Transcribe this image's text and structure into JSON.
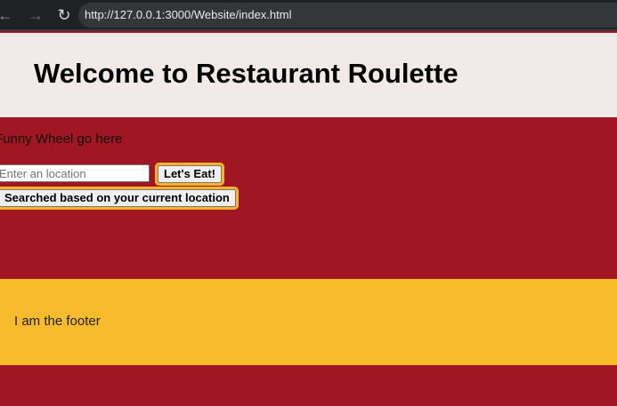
{
  "browser": {
    "url": "http://127.0.0.1:3000/Website/index.html",
    "back_icon": "←",
    "forward_icon": "→",
    "reload_icon": "↻"
  },
  "header": {
    "title": "Welcome to Restaurant Roulette"
  },
  "main": {
    "wheel_text": "Funny Wheel go here",
    "location_placeholder": "Enter an location",
    "location_value": "",
    "eat_button_label": "Let's Eat!",
    "current_location_button_label": "Searched based on your current location"
  },
  "footer": {
    "text": "I am the footer"
  },
  "colors": {
    "header_bg": "#f1eae8",
    "main_bg": "#a01622",
    "footer_bg": "#f8bb2c",
    "button_outline": "#f6b32b"
  }
}
